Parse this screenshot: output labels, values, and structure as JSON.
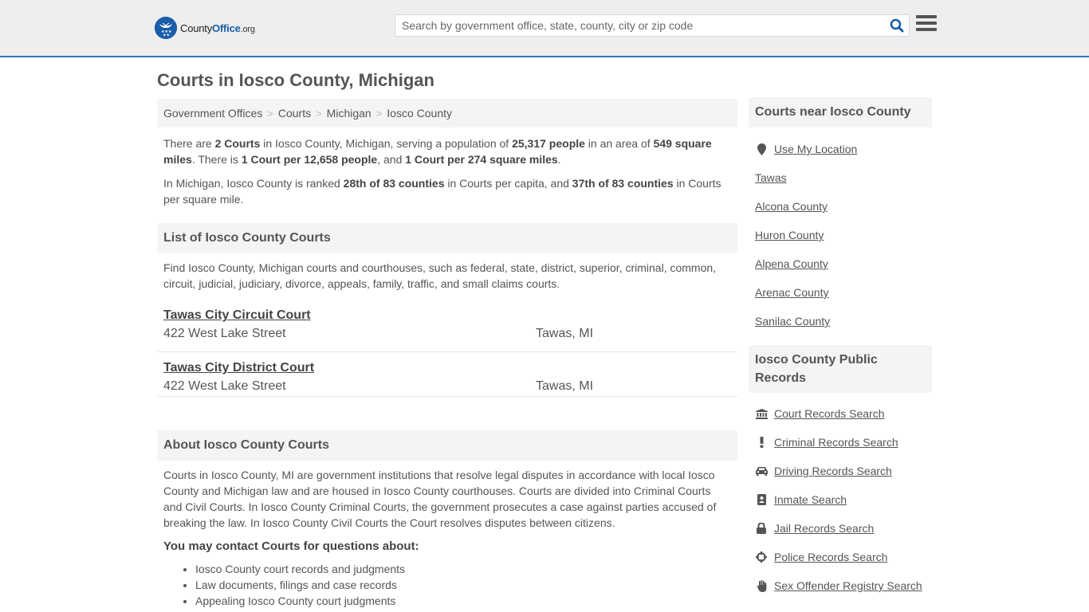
{
  "header": {
    "logo": {
      "prefix": "County",
      "brand": "Office",
      "tld": ".org"
    },
    "search": {
      "placeholder": "Search by government office, state, county, city or zip code",
      "value": ""
    },
    "accent_color": "#337ab7",
    "brand_color": "#1a5da8"
  },
  "page": {
    "title": "Courts in Iosco County, Michigan"
  },
  "breadcrumb": [
    {
      "label": "Government Offices"
    },
    {
      "label": "Courts"
    },
    {
      "label": "Michigan"
    },
    {
      "label": "Iosco County"
    }
  ],
  "summary": {
    "p1": {
      "t1": "There are ",
      "b1": "2 Courts",
      "t2": " in Iosco County, Michigan, serving a population of ",
      "b2": "25,317 people",
      "t3": " in an area of ",
      "b3": "549 square miles",
      "t4": ". There is ",
      "b4": "1 Court per 12,658 people",
      "t5": ", and ",
      "b5": "1 Court per 274 square miles",
      "t6": "."
    },
    "p2": {
      "t1": "In Michigan, Iosco County is ranked ",
      "b1": "28th of 83 counties",
      "t2": " in Courts per capita, and ",
      "b2": "37th of 83 counties",
      "t3": " in Courts per square mile."
    }
  },
  "list_section": {
    "title": "List of Iosco County Courts",
    "description": "Find Iosco County, Michigan courts and courthouses, such as federal, state, district, superior, criminal, common, circuit, judicial, judiciary, divorce, appeals, family, traffic, and small claims courts.",
    "courts": [
      {
        "name": "Tawas City Circuit Court",
        "address": "422 West Lake Street",
        "city": "Tawas, MI"
      },
      {
        "name": "Tawas City District Court",
        "address": "422 West Lake Street",
        "city": "Tawas, MI"
      }
    ]
  },
  "about_section": {
    "title": "About Iosco County Courts",
    "text": "Courts in Iosco County, MI are government institutions that resolve legal disputes in accordance with local Iosco County and Michigan law and are housed in Iosco County courthouses. Courts are divided into Criminal Courts and Civil Courts. In Iosco County Criminal Courts, the government prosecutes a case against parties accused of breaking the law. In Iosco County Civil Courts the Court resolves disputes between citizens.",
    "contact_heading": "You may contact Courts for questions about:",
    "contact_items": [
      "Iosco County court records and judgments",
      "Law documents, filings and case records",
      "Appealing Iosco County court judgments"
    ]
  },
  "sidebar": {
    "near": {
      "title": "Courts near Iosco County",
      "use_location": {
        "label": "Use My Location",
        "icon": "map-marker-icon"
      },
      "links": [
        "Tawas",
        "Alcona County",
        "Huron County",
        "Alpena County",
        "Arenac County",
        "Sanilac County"
      ]
    },
    "records": {
      "title": "Iosco County Public Records",
      "links": [
        {
          "label": "Court Records Search",
          "icon": "courthouse-icon"
        },
        {
          "label": "Criminal Records Search",
          "icon": "exclamation-icon"
        },
        {
          "label": "Driving Records Search",
          "icon": "car-icon"
        },
        {
          "label": "Inmate Search",
          "icon": "id-badge-icon"
        },
        {
          "label": "Jail Records Search",
          "icon": "lock-icon"
        },
        {
          "label": "Police Records Search",
          "icon": "crosshairs-icon"
        },
        {
          "label": "Sex Offender Registry Search",
          "icon": "hand-icon"
        }
      ]
    }
  }
}
